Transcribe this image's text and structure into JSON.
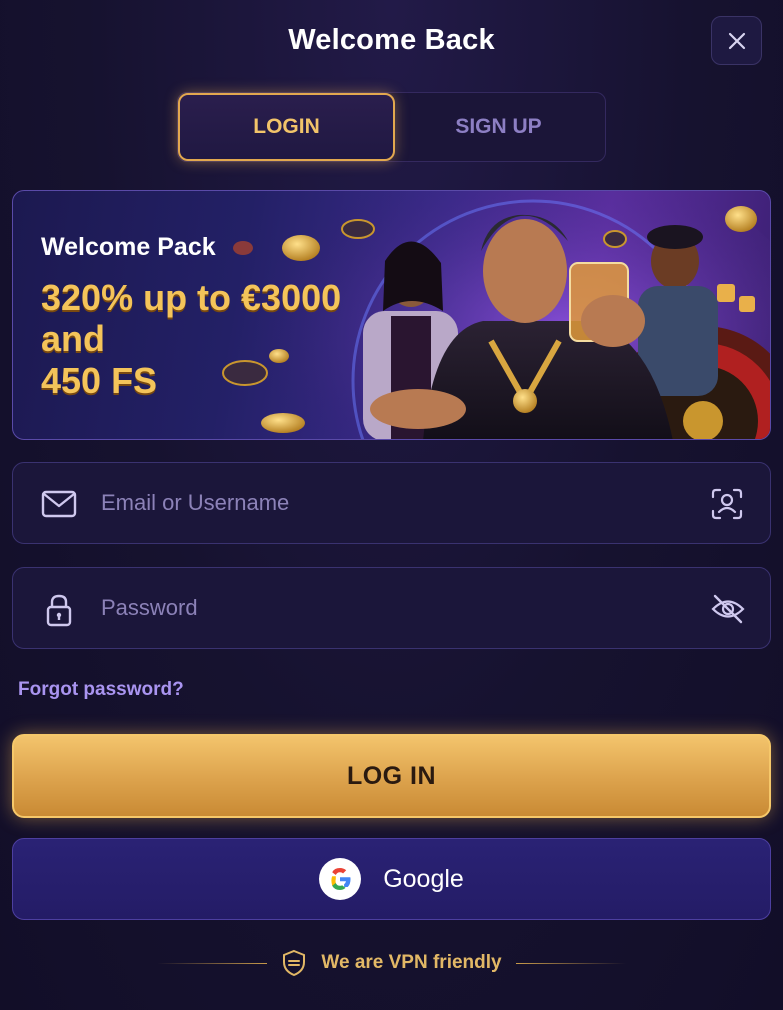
{
  "header": {
    "title": "Welcome Back"
  },
  "tabs": [
    {
      "label": "LOGIN",
      "active": true
    },
    {
      "label": "SIGN UP",
      "active": false
    }
  ],
  "banner": {
    "label": "Welcome Pack",
    "offer_line1": "320% up to €3000 and",
    "offer_line2": "450 FS"
  },
  "form": {
    "email_placeholder": "Email or Username",
    "email_value": "",
    "password_placeholder": "Password",
    "password_value": "",
    "forgot_label": "Forgot password?",
    "submit_label": "LOG IN",
    "google_label": "Google"
  },
  "footer": {
    "vpn_text": "We are VPN friendly"
  },
  "colors": {
    "accent_gold": "#f2c46a",
    "background": "#15112e",
    "link": "#a994f0",
    "google_button": "#241c66"
  },
  "icons": [
    "close-icon",
    "email-icon",
    "face-scan-icon",
    "lock-icon",
    "eye-off-icon",
    "google-icon",
    "shield-icon"
  ]
}
